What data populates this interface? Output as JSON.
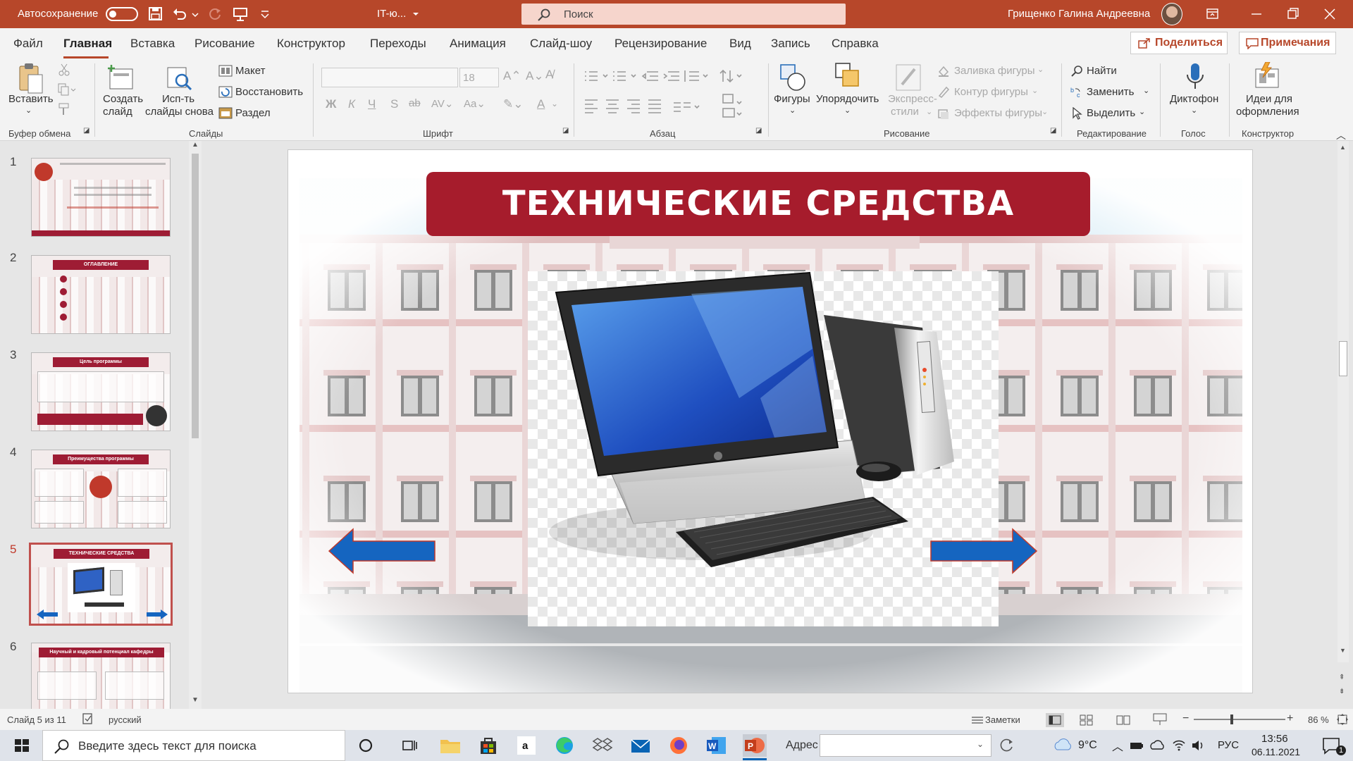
{
  "titlebar": {
    "autosave": "Автосохранение",
    "toggle": "Откл.",
    "filename": "IT-ю...",
    "search_placeholder": "Поиск",
    "user": "Грищенко Галина Андреевна"
  },
  "menu": {
    "items": [
      "Файл",
      "Главная",
      "Вставка",
      "Рисование",
      "Конструктор",
      "Переходы",
      "Анимация",
      "Слайд-шоу",
      "Рецензирование",
      "Вид",
      "Запись",
      "Справка"
    ],
    "share": "Поделиться",
    "notes": "Примечания"
  },
  "ribbon": {
    "paste": "Вставить",
    "clipboard_group": "Буфер обмена",
    "new_slide_1": "Создать",
    "new_slide_2": "слайд",
    "reuse_1": "Исп-ть",
    "reuse_2": "слайды снова",
    "layout": "Макет",
    "reset": "Восстановить",
    "section": "Раздел",
    "slides_group": "Слайды",
    "font_size": "18",
    "font_group": "Шрифт",
    "paragraph_group": "Абзац",
    "shapes": "Фигуры",
    "arrange": "Упорядочить",
    "quick_1": "Экспресс-",
    "quick_2": "стили",
    "fill": "Заливка фигуры",
    "outline": "Контур фигуры",
    "effects": "Эффекты фигуры",
    "drawing_group": "Рисование",
    "find": "Найти",
    "replace": "Заменить",
    "select": "Выделить",
    "editing_group": "Редактирование",
    "dictate": "Диктофон",
    "voice_group": "Голос",
    "ideas_1": "Идеи для",
    "ideas_2": "оформления",
    "designer_group": "Конструктор"
  },
  "thumbnails": [
    {
      "num": "1",
      "head": ""
    },
    {
      "num": "2",
      "head": "ОГЛАВЛЕНИЕ"
    },
    {
      "num": "3",
      "head": "Цель программы"
    },
    {
      "num": "4",
      "head": "Преимущества программы"
    },
    {
      "num": "5",
      "head": "ТЕХНИЧЕСКИЕ СРЕДСТВА"
    },
    {
      "num": "6",
      "head": "Научный и кадровый потенциал кафедры"
    }
  ],
  "slide": {
    "title": "ТЕХНИЧЕСКИЕ СРЕДСТВА"
  },
  "status": {
    "slide_info": "Слайд 5 из 11",
    "language": "русский",
    "notes": "Заметки",
    "zoom": "86 %"
  },
  "taskbar": {
    "search_placeholder": "Введите здесь текст для поиска",
    "address_label": "Адрес",
    "weather": "9°C",
    "lang": "РУС",
    "time": "13:56",
    "date": "06.11.2021",
    "notifications": "1"
  },
  "colors": {
    "accent": "#b7472a",
    "title_bg": "#a61c2c",
    "arrow": "#1565c0"
  }
}
